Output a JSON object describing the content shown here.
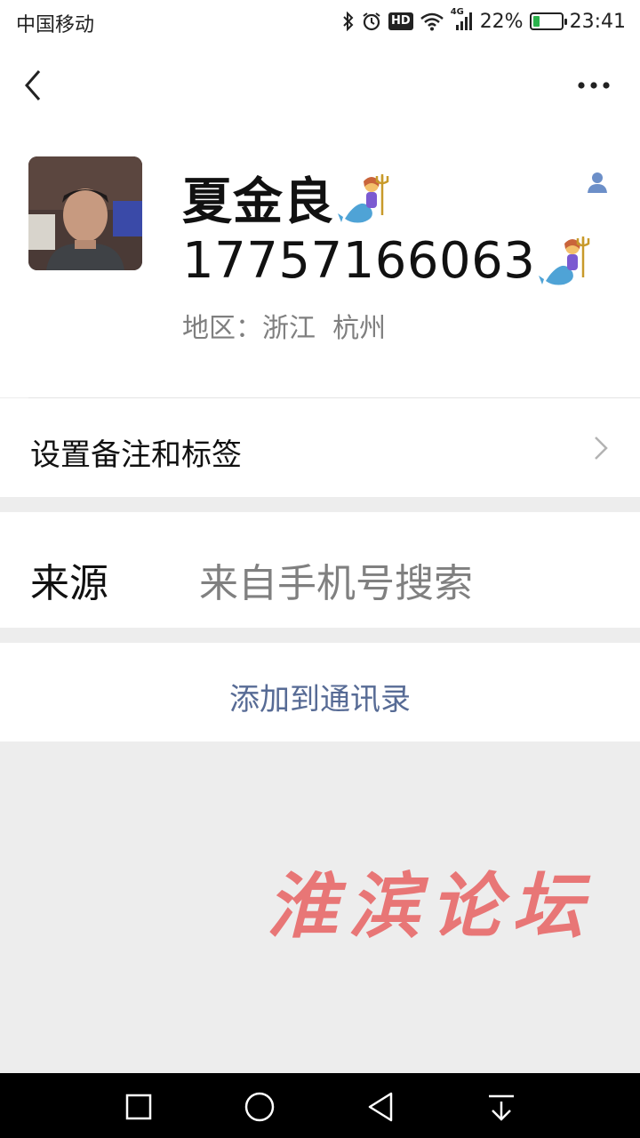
{
  "status_bar": {
    "carrier": "中国移动",
    "hd": "HD",
    "network": "4G",
    "battery_percent": "22%",
    "battery_level": 0.22,
    "time": "23:41"
  },
  "profile": {
    "name": "夏金良",
    "phone": "17757166063",
    "region": "地区：浙江  杭州"
  },
  "remark": {
    "label": "设置备注和标签"
  },
  "source": {
    "label": "来源",
    "value": "来自手机号搜索"
  },
  "actions": {
    "add_contact": "添加到通讯录"
  },
  "watermark": "淮滨论坛",
  "colors": {
    "link": "#576b95",
    "background": "#ededed",
    "watermark": "#e86a6a",
    "battery": "#2bb24c"
  }
}
